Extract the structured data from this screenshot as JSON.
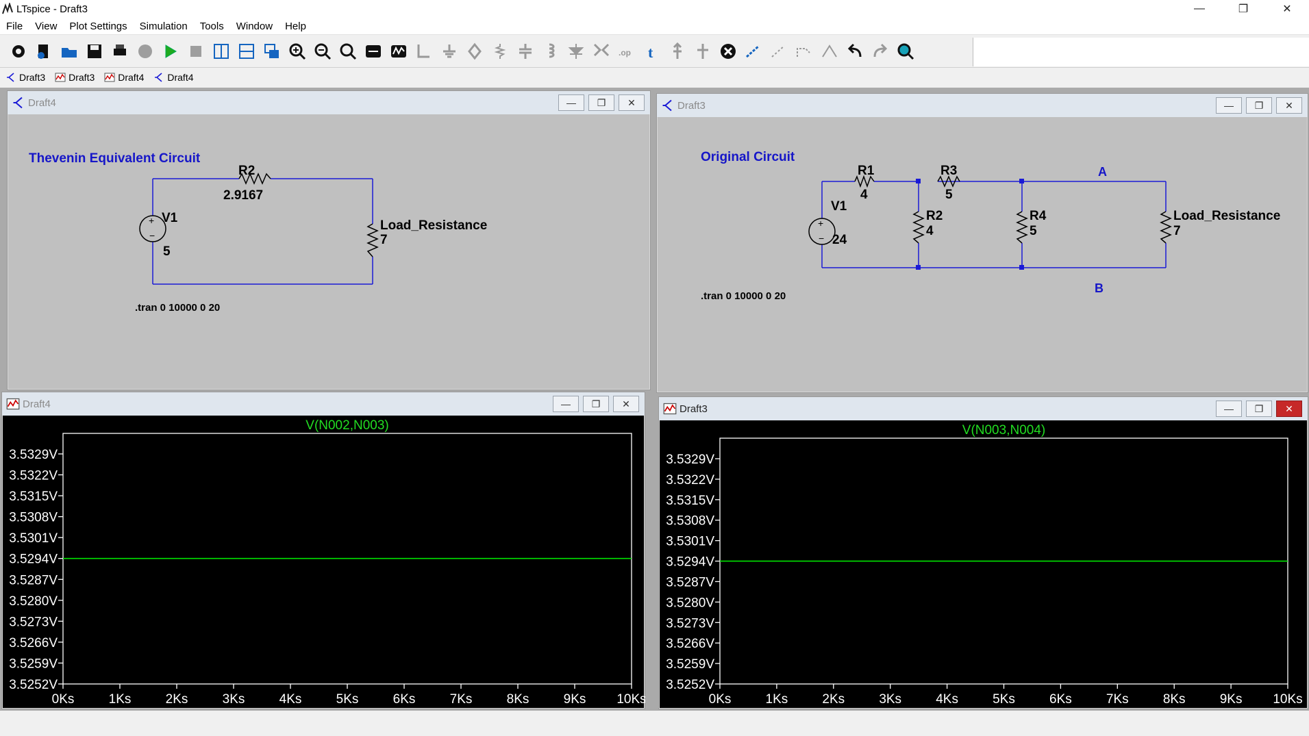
{
  "app": {
    "title": "LTspice - Draft3"
  },
  "window_controls": {
    "minimize": "—",
    "restore": "❐",
    "close": "✕"
  },
  "menu": [
    "File",
    "View",
    "Plot Settings",
    "Simulation",
    "Tools",
    "Window",
    "Help"
  ],
  "toolbar_icons": [
    "settings-icon",
    "new-schematic-icon",
    "open-icon",
    "save-icon",
    "print-icon",
    "halt-icon",
    "run-icon",
    "stop-icon",
    "tile-vertical-icon",
    "tile-horizontal-icon",
    "cascade-icon",
    "zoom-in-icon",
    "zoom-out-icon",
    "zoom-fit-icon",
    "autorange-icon",
    "waveform-icon",
    "wire-icon",
    "ground-icon",
    "label-net-icon",
    "resistor-icon",
    "capacitor-icon",
    "inductor-icon",
    "diode-icon",
    "component-icon",
    "spice-directive-icon",
    "text-icon",
    "move-icon",
    "drag-icon",
    "delete-icon",
    "duplicate-icon",
    "copy-icon",
    "rotate-icon",
    "mirror-icon",
    "undo-icon",
    "redo-icon",
    "find-icon"
  ],
  "tabs": [
    {
      "label": "Draft3",
      "kind": "schematic"
    },
    {
      "label": "Draft3",
      "kind": "plot"
    },
    {
      "label": "Draft4",
      "kind": "plot"
    },
    {
      "label": "Draft4",
      "kind": "schematic"
    }
  ],
  "win_thevenin": {
    "title": "Draft4",
    "heading": "Thevenin Equivalent Circuit",
    "r2_name": "R2",
    "r2_value": "2.9167",
    "v1_name": "V1",
    "v1_value": "5",
    "load_name": "Load_Resistance",
    "load_value": "7",
    "directive": ".tran 0 10000 0 20",
    "btn_min": "—",
    "btn_max": "❐",
    "btn_close": "✕"
  },
  "win_original": {
    "title": "Draft3",
    "heading": "Original Circuit",
    "r1_name": "R1",
    "r1_value": "4",
    "r2_name": "R2",
    "r2_value": "4",
    "r3_name": "R3",
    "r3_value": "5",
    "r4_name": "R4",
    "r4_value": "5",
    "v1_name": "V1",
    "v1_value": "24",
    "load_name": "Load_Resistance",
    "load_value": "7",
    "node_a": "A",
    "node_b": "B",
    "directive": ".tran 0 10000 0 20",
    "btn_min": "—",
    "btn_max": "❐",
    "btn_close": "✕"
  },
  "plot_left": {
    "title": "Draft4",
    "btn_min": "—",
    "btn_max": "❐",
    "btn_close": "✕"
  },
  "plot_right": {
    "title": "Draft3",
    "btn_min": "—",
    "btn_max": "❐",
    "btn_close": "✕"
  },
  "colors": {
    "trace": "#00e400",
    "schematic_wire": "#1a1ad6",
    "heading": "#1616c8"
  },
  "chart_data": [
    {
      "type": "line",
      "title": "V(N002,N003)",
      "x": [
        "0Ks",
        "1Ks",
        "2Ks",
        "3Ks",
        "4Ks",
        "5Ks",
        "6Ks",
        "7Ks",
        "8Ks",
        "9Ks",
        "10Ks"
      ],
      "y_ticks": [
        "3.5329V",
        "3.5322V",
        "3.5315V",
        "3.5308V",
        "3.5301V",
        "3.5294V",
        "3.5287V",
        "3.5280V",
        "3.5273V",
        "3.5266V",
        "3.5259V",
        "3.5252V"
      ],
      "xlim": [
        0,
        10000
      ],
      "ylim": [
        3.5252,
        3.5329
      ],
      "series": [
        {
          "name": "V(N002,N003)",
          "values": [
            3.5294,
            3.5294
          ],
          "x": [
            0,
            10000
          ]
        }
      ],
      "grid": false
    },
    {
      "type": "line",
      "title": "V(N003,N004)",
      "x": [
        "0Ks",
        "1Ks",
        "2Ks",
        "3Ks",
        "4Ks",
        "5Ks",
        "6Ks",
        "7Ks",
        "8Ks",
        "9Ks",
        "10Ks"
      ],
      "y_ticks": [
        "3.5329V",
        "3.5322V",
        "3.5315V",
        "3.5308V",
        "3.5301V",
        "3.5294V",
        "3.5287V",
        "3.5280V",
        "3.5273V",
        "3.5266V",
        "3.5259V",
        "3.5252V"
      ],
      "xlim": [
        0,
        10000
      ],
      "ylim": [
        3.5252,
        3.5329
      ],
      "series": [
        {
          "name": "V(N003,N004)",
          "values": [
            3.5294,
            3.5294
          ],
          "x": [
            0,
            10000
          ]
        }
      ],
      "grid": false
    }
  ]
}
